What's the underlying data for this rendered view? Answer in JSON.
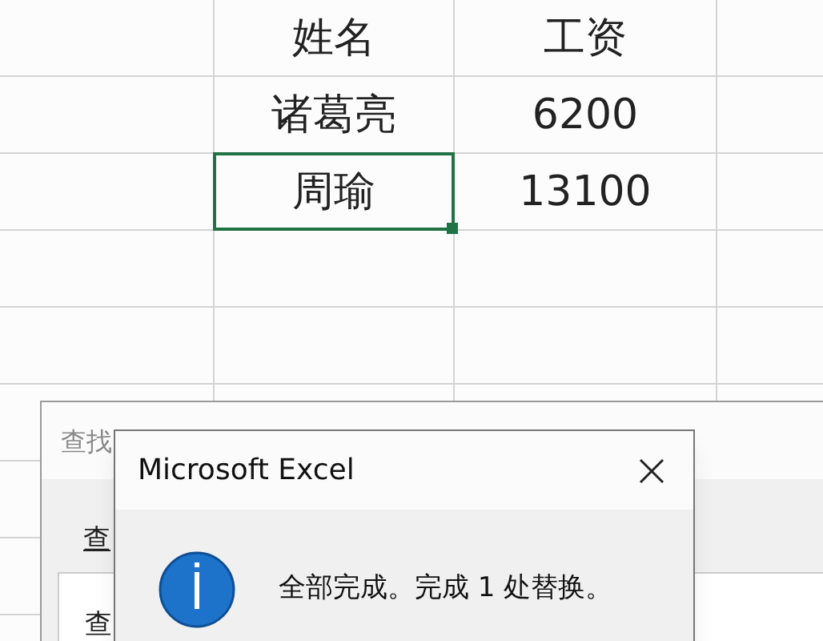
{
  "sheet": {
    "rows": [
      [
        {
          "text": "姓名",
          "selected": false
        },
        {
          "text": "工资",
          "selected": false
        }
      ],
      [
        {
          "text": "诸葛亮",
          "selected": false
        },
        {
          "text": "6200",
          "selected": false
        }
      ],
      [
        {
          "text": "周瑜",
          "selected": true
        },
        {
          "text": "13100",
          "selected": false
        }
      ]
    ]
  },
  "find_replace_dialog": {
    "title": "查找",
    "tab": "查",
    "field_label": "查"
  },
  "message_box": {
    "title": "Microsoft Excel",
    "message": "全部完成。完成 1 处替换。"
  }
}
